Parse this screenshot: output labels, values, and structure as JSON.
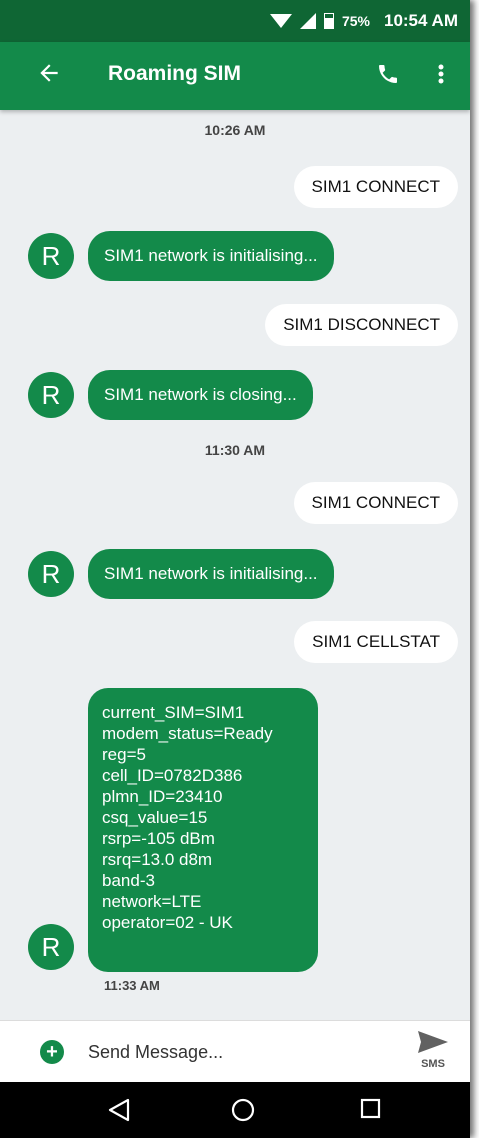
{
  "status_bar": {
    "battery": "75%",
    "time": "10:54 AM"
  },
  "app_bar": {
    "title": "Roaming SIM"
  },
  "conversation": {
    "timestamp_1": "10:26 AM",
    "sent_1": "SIM1 CONNECT",
    "received_1": "SIM1 network is initialising...",
    "sent_2": "SIM1 DISCONNECT",
    "received_2": "SIM1 network is closing...",
    "timestamp_2": "11:30 AM",
    "sent_3": "SIM1 CONNECT",
    "received_3": "SIM1 network is initialising...",
    "sent_4": "SIM1 CELLSTAT",
    "received_4_lines": [
      "current_SIM=SIM1",
      "modem_status=Ready",
      "reg=5",
      "cell_ID=0782D386",
      "plmn_ID=23410",
      "csq_value=15",
      "rsrp=-105 dBm",
      "rsrq=13.0 d8m",
      "band-3",
      "network=LTE",
      "operator=02 - UK"
    ],
    "received_4_time": "11:33 AM",
    "avatar_letter": "R"
  },
  "compose": {
    "placeholder": "Send Message...",
    "send_label": "SMS"
  },
  "icons": {
    "back": "arrow-left-icon",
    "call": "phone-icon",
    "menu": "more-vert-icon",
    "add": "add-circle-icon",
    "send": "send-icon"
  },
  "colors": {
    "status_bar": "#0f6634",
    "app_bar": "#138a4a",
    "incoming_bubble": "#138a4a",
    "outgoing_bubble": "#ffffff",
    "background": "#eceff1"
  }
}
